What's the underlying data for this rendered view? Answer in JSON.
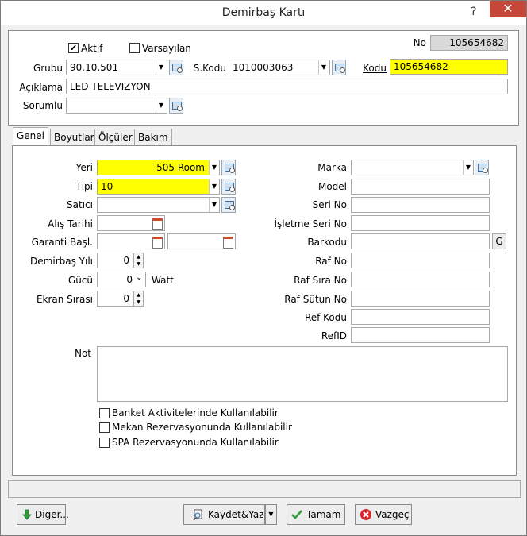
{
  "window": {
    "title": "Demirbaş Kartı",
    "help": "?",
    "close": "✕"
  },
  "header": {
    "aktif_label": "Aktif",
    "aktif_checked": "✔",
    "varsayilan_label": "Varsayılan",
    "varsayilan_checked": "",
    "no_label": "No",
    "no_value": "105654682",
    "grubu_label": "Grubu",
    "grubu_value": "90.10.501",
    "skodu_label": "S.Kodu",
    "skodu_value": "1010003063",
    "kodu_label": "Kodu",
    "kodu_value": "105654682",
    "aciklama_label": "Açıklama",
    "aciklama_value": "LED TELEVIZYON",
    "sorumlu_label": "Sorumlu",
    "sorumlu_value": ""
  },
  "tabs": [
    {
      "label": "Genel"
    },
    {
      "label": "Boyutlar"
    },
    {
      "label": "Ölçüler"
    },
    {
      "label": "Bakım"
    }
  ],
  "genel": {
    "yeri_label": "Yeri",
    "yeri_value": "505 Room",
    "tipi_label": "Tipi",
    "tipi_value": "10",
    "satici_label": "Satıcı",
    "satici_value": "",
    "alis_tarihi_label": "Alış Tarihi",
    "alis_tarihi_value": "",
    "garanti_label": "Garanti Başl.",
    "garanti_start_value": "",
    "garanti_end_value": "",
    "demirbas_yili_label": "Demirbaş Yılı",
    "demirbas_yili_value": "0",
    "gucu_label": "Gücü",
    "gucu_value": "0",
    "gucu_unit": "Watt",
    "ekran_sirasi_label": "Ekran Sırası",
    "ekran_sirasi_value": "0",
    "marka_label": "Marka",
    "marka_value": "",
    "model_label": "Model",
    "model_value": "",
    "seri_no_label": "Seri No",
    "seri_no_value": "",
    "isletme_seri_no_label": "İşletme Seri No",
    "isletme_seri_no_value": "",
    "barkodu_label": "Barkodu",
    "barkodu_value": "",
    "barkodu_button": "G",
    "raf_no_label": "Raf No",
    "raf_no_value": "",
    "raf_sira_no_label": "Raf Sıra No",
    "raf_sira_no_value": "",
    "raf_sutun_no_label": "Raf Sütun No",
    "raf_sutun_no_value": "",
    "ref_kodu_label": "Ref Kodu",
    "ref_kodu_value": "",
    "refid_label": "RefID",
    "refid_value": "",
    "not_label": "Not",
    "not_value": "",
    "checks": [
      {
        "label": "Banket Aktivitelerinde Kullanılabilir",
        "mark": ""
      },
      {
        "label": "Mekan Rezervasyonunda Kullanılabilir",
        "mark": ""
      },
      {
        "label": "SPA Rezervasyonunda Kullanılabilir",
        "mark": ""
      }
    ]
  },
  "footer": {
    "diger_label": "Diger...",
    "kaydet_label": "Kaydet&Yaz",
    "tamam_label": "Tamam",
    "vazgec_label": "Vazgeç",
    "status": ""
  },
  "colors": {
    "highlight": "#ffff00",
    "close": "#c7463a",
    "readonly": "#d9d9d9"
  }
}
